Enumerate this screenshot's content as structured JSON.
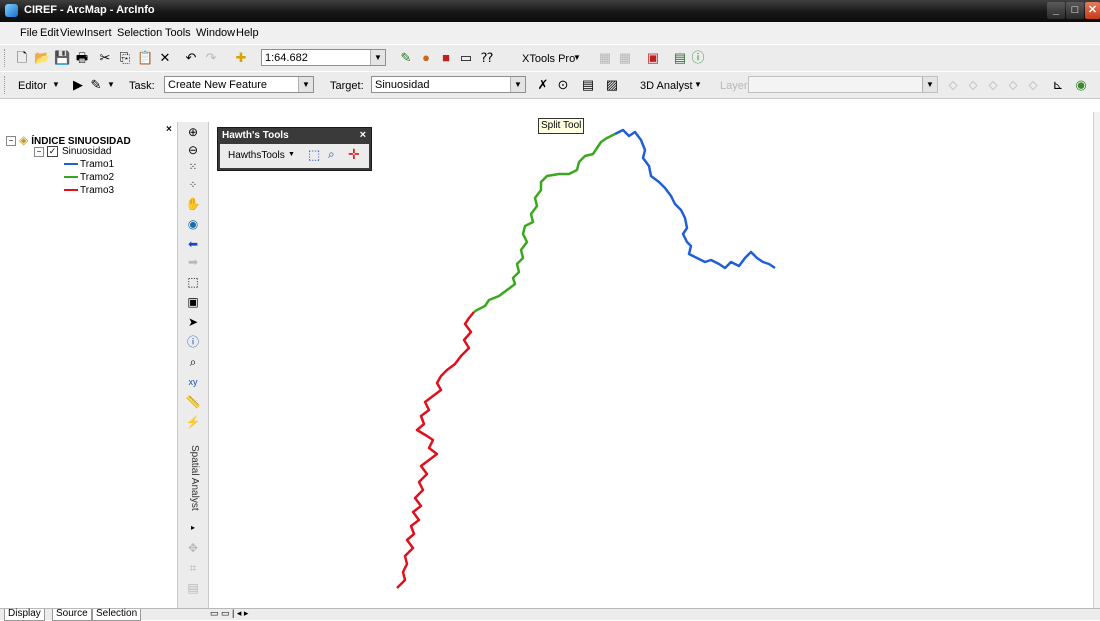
{
  "window": {
    "title": "CIREF - ArcMap - ArcInfo"
  },
  "menu": [
    "File",
    "Edit",
    "View",
    "Insert",
    "Selection",
    "Tools",
    "Window",
    "Help"
  ],
  "standard_toolbar": {
    "map_scale": "1:64.682",
    "xtools_label": "XTools Pro"
  },
  "editor_toolbar": {
    "editor_label": "Editor",
    "task_label": "Task:",
    "task_value": "Create New Feature",
    "target_label": "Target:",
    "target_value": "Sinuosidad",
    "analyst3d_label": "3D Analyst",
    "layer_label": "Layer:"
  },
  "toc": {
    "dataframe": "ÍNDICE SINUOSIDAD",
    "layer": "Sinuosidad",
    "legend": [
      {
        "label": "Tramo1",
        "color": "#1f5fd6"
      },
      {
        "label": "Tramo2",
        "color": "#3aa81e"
      },
      {
        "label": "Tramo3",
        "color": "#e0101c"
      }
    ],
    "tabs": [
      "Display",
      "Source",
      "Selection"
    ]
  },
  "hawths": {
    "title": "Hawth's Tools",
    "menu_label": "HawthsTools"
  },
  "tooltip": "Split Tool",
  "vertical_label": "Spatial Analyst",
  "colors": {
    "tramo1": "#1f5fd6",
    "tramo2": "#3aa81e",
    "tramo3": "#e0101c"
  }
}
